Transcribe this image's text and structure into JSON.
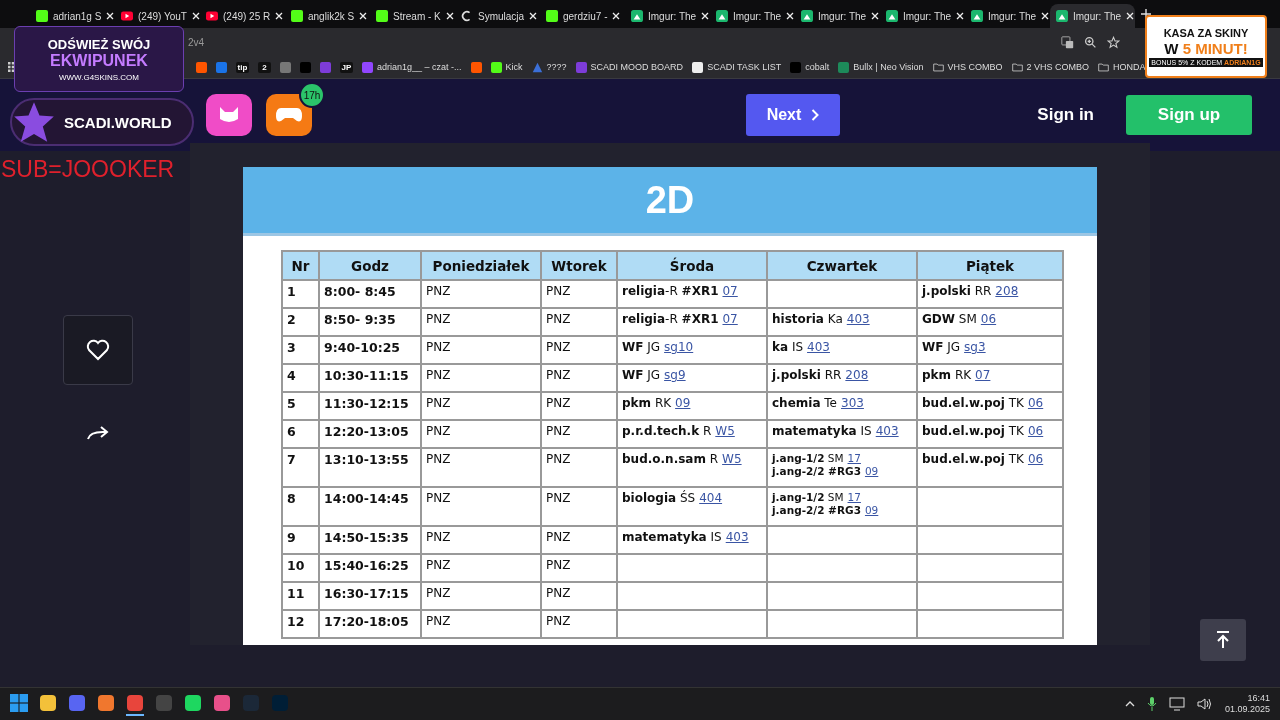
{
  "browser": {
    "tabs": [
      {
        "title": "adrian1g S",
        "kind": "kick",
        "selected": false
      },
      {
        "title": "(249) YouT",
        "kind": "youtube",
        "selected": false
      },
      {
        "title": "(249) 25 R",
        "kind": "youtube",
        "selected": false
      },
      {
        "title": "anglik2k S",
        "kind": "kick",
        "selected": false
      },
      {
        "title": "Stream - K",
        "kind": "kick",
        "selected": false
      },
      {
        "title": "Symulacja",
        "kind": "generic",
        "selected": false
      },
      {
        "title": "gerdziu7 -",
        "kind": "kick",
        "selected": false
      },
      {
        "title": "Imgur: The",
        "kind": "imgur",
        "selected": false
      },
      {
        "title": "Imgur: The",
        "kind": "imgur",
        "selected": false
      },
      {
        "title": "Imgur: The",
        "kind": "imgur",
        "selected": false
      },
      {
        "title": "Imgur: The",
        "kind": "imgur",
        "selected": false
      },
      {
        "title": "Imgur: The",
        "kind": "imgur",
        "selected": false
      },
      {
        "title": "Imgur: The",
        "kind": "imgur",
        "selected": true
      }
    ],
    "address": "2v4",
    "bookmarks": [
      {
        "kind": "soundcloud"
      },
      {
        "kind": "paypal"
      },
      {
        "kind": "text",
        "glyph": "tip"
      },
      {
        "kind": "text",
        "glyph": "2"
      },
      {
        "kind": "epic"
      },
      {
        "kind": "tiktok"
      },
      {
        "kind": "purple"
      },
      {
        "kind": "text",
        "glyph": "JP"
      },
      {
        "kind": "twitch",
        "label": "adrian1g__ – czat -..."
      },
      {
        "kind": "soundcloud"
      },
      {
        "kind": "kick",
        "label": "Kick"
      },
      {
        "kind": "triangle",
        "label": "????"
      },
      {
        "kind": "purple",
        "label": "SCADI MOOD BOARD"
      },
      {
        "kind": "notion",
        "label": "SCADI TASK LIST"
      },
      {
        "kind": "terminal",
        "label": "cobalt"
      },
      {
        "kind": "bull",
        "label": "Bullx | Neo Vision"
      },
      {
        "kind": "folder",
        "label": "VHS COMBO"
      },
      {
        "kind": "folder",
        "label": "2 VHS COMBO"
      },
      {
        "kind": "folder",
        "label": "HONDA"
      }
    ]
  },
  "page": {
    "apps": [
      {
        "kind": "pink"
      },
      {
        "kind": "gamepad",
        "badge": "17h"
      }
    ],
    "next_button": "Next",
    "sign_in": "Sign in",
    "sign_up": "Sign up",
    "image": {
      "title": "2D",
      "table": {
        "columns": [
          "Nr",
          "Godz",
          "Poniedziałek",
          "Wtorek",
          "Środa",
          "Czwartek",
          "Piątek"
        ],
        "rows": [
          {
            "cells": [
              {
                "entries": [
                  {
                    "text": "1"
                  }
                ]
              },
              {
                "entries": [
                  {
                    "text": "8:00- 8:45"
                  }
                ]
              },
              {
                "entries": [
                  {
                    "text": "PNZ"
                  }
                ]
              },
              {
                "entries": [
                  {
                    "text": "PNZ"
                  }
                ]
              },
              {
                "entries": [
                  {
                    "text": "**religia**-R **#XR1**",
                    "room": "07"
                  }
                ]
              },
              {},
              {
                "entries": [
                  {
                    "text": "**j.polski** RR",
                    "room": "208"
                  }
                ]
              }
            ]
          },
          {
            "cells": [
              {
                "entries": [
                  {
                    "text": "2"
                  }
                ]
              },
              {
                "entries": [
                  {
                    "text": "8:50- 9:35"
                  }
                ]
              },
              {
                "entries": [
                  {
                    "text": "PNZ"
                  }
                ]
              },
              {
                "entries": [
                  {
                    "text": "PNZ"
                  }
                ]
              },
              {
                "entries": [
                  {
                    "text": "**religia**-R **#XR1**",
                    "room": "07"
                  }
                ]
              },
              {
                "entries": [
                  {
                    "text": "**historia** Ka",
                    "room": "403"
                  }
                ]
              },
              {
                "entries": [
                  {
                    "text": "**GDW** SM",
                    "room": "06"
                  }
                ]
              }
            ]
          },
          {
            "cells": [
              {
                "entries": [
                  {
                    "text": "3"
                  }
                ]
              },
              {
                "entries": [
                  {
                    "text": "9:40-10:25"
                  }
                ]
              },
              {
                "entries": [
                  {
                    "text": "PNZ"
                  }
                ]
              },
              {
                "entries": [
                  {
                    "text": "PNZ"
                  }
                ]
              },
              {
                "entries": [
                  {
                    "text": "**WF** JG",
                    "room": "sg10"
                  }
                ]
              },
              {
                "entries": [
                  {
                    "text": "**ka** IS",
                    "room": "403"
                  }
                ]
              },
              {
                "entries": [
                  {
                    "text": "**WF** JG",
                    "room": "sg3"
                  }
                ]
              }
            ]
          },
          {
            "cells": [
              {
                "entries": [
                  {
                    "text": "4"
                  }
                ]
              },
              {
                "entries": [
                  {
                    "text": "10:30-11:15"
                  }
                ]
              },
              {
                "entries": [
                  {
                    "text": "PNZ"
                  }
                ]
              },
              {
                "entries": [
                  {
                    "text": "PNZ"
                  }
                ]
              },
              {
                "entries": [
                  {
                    "text": "**WF** JG",
                    "room": "sg9"
                  }
                ]
              },
              {
                "entries": [
                  {
                    "text": "**j.polski** RR",
                    "room": "208"
                  }
                ]
              },
              {
                "entries": [
                  {
                    "text": "**pkm** RK",
                    "room": "07"
                  }
                ]
              }
            ]
          },
          {
            "cells": [
              {
                "entries": [
                  {
                    "text": "5"
                  }
                ]
              },
              {
                "entries": [
                  {
                    "text": "11:30-12:15"
                  }
                ]
              },
              {
                "entries": [
                  {
                    "text": "PNZ"
                  }
                ]
              },
              {
                "entries": [
                  {
                    "text": "PNZ"
                  }
                ]
              },
              {
                "entries": [
                  {
                    "text": "**pkm** RK",
                    "room": "09"
                  }
                ]
              },
              {
                "entries": [
                  {
                    "text": "**chemia** Te",
                    "room": "303"
                  }
                ]
              },
              {
                "entries": [
                  {
                    "text": "**bud.el.w.poj** TK",
                    "room": "06"
                  }
                ]
              }
            ]
          },
          {
            "cells": [
              {
                "entries": [
                  {
                    "text": "6"
                  }
                ]
              },
              {
                "entries": [
                  {
                    "text": "12:20-13:05"
                  }
                ]
              },
              {
                "entries": [
                  {
                    "text": "PNZ"
                  }
                ]
              },
              {
                "entries": [
                  {
                    "text": "PNZ"
                  }
                ]
              },
              {
                "entries": [
                  {
                    "text": "**p.r.d.tech.k** R",
                    "room": "W5"
                  }
                ]
              },
              {
                "entries": [
                  {
                    "text": "**matematyka** IS",
                    "room": "403"
                  }
                ]
              },
              {
                "entries": [
                  {
                    "text": "**bud.el.w.poj** TK",
                    "room": "06"
                  }
                ]
              }
            ]
          },
          {
            "cells": [
              {
                "entries": [
                  {
                    "text": "7"
                  }
                ]
              },
              {
                "entries": [
                  {
                    "text": "13:10-13:55"
                  }
                ]
              },
              {
                "entries": [
                  {
                    "text": "PNZ"
                  }
                ]
              },
              {
                "entries": [
                  {
                    "text": "PNZ"
                  }
                ]
              },
              {
                "entries": [
                  {
                    "text": "**bud.o.n.sam** R",
                    "room": "W5"
                  }
                ]
              },
              {
                "entries": [
                  {
                    "text": "**j.ang-1/2** SM",
                    "room": "17"
                  },
                  {
                    "text": "**j.ang-2/2 #RG3**",
                    "room": "09"
                  }
                ]
              },
              {
                "entries": [
                  {
                    "text": "**bud.el.w.poj** TK",
                    "room": "06"
                  }
                ]
              }
            ]
          },
          {
            "cells": [
              {
                "entries": [
                  {
                    "text": "8"
                  }
                ]
              },
              {
                "entries": [
                  {
                    "text": "14:00-14:45"
                  }
                ]
              },
              {
                "entries": [
                  {
                    "text": "PNZ"
                  }
                ]
              },
              {
                "entries": [
                  {
                    "text": "PNZ"
                  }
                ]
              },
              {
                "entries": [
                  {
                    "text": "**biologia** ŚS",
                    "room": "404"
                  }
                ]
              },
              {
                "entries": [
                  {
                    "text": "**j.ang-1/2** SM",
                    "room": "17"
                  },
                  {
                    "text": "**j.ang-2/2 #RG3**",
                    "room": "09"
                  }
                ]
              },
              {}
            ]
          },
          {
            "cells": [
              {
                "entries": [
                  {
                    "text": "9"
                  }
                ]
              },
              {
                "entries": [
                  {
                    "text": "14:50-15:35"
                  }
                ]
              },
              {
                "entries": [
                  {
                    "text": "PNZ"
                  }
                ]
              },
              {
                "entries": [
                  {
                    "text": "PNZ"
                  }
                ]
              },
              {
                "entries": [
                  {
                    "text": "**matematyka** IS",
                    "room": "403"
                  }
                ]
              },
              {},
              {}
            ]
          },
          {
            "cells": [
              {
                "entries": [
                  {
                    "text": "10"
                  }
                ]
              },
              {
                "entries": [
                  {
                    "text": "15:40-16:25"
                  }
                ]
              },
              {
                "entries": [
                  {
                    "text": "PNZ"
                  }
                ]
              },
              {
                "entries": [
                  {
                    "text": "PNZ"
                  }
                ]
              },
              {},
              {},
              {}
            ]
          },
          {
            "cells": [
              {
                "entries": [
                  {
                    "text": "11"
                  }
                ]
              },
              {
                "entries": [
                  {
                    "text": "16:30-17:15"
                  }
                ]
              },
              {
                "entries": [
                  {
                    "text": "PNZ"
                  }
                ]
              },
              {
                "entries": [
                  {
                    "text": "PNZ"
                  }
                ]
              },
              {},
              {},
              {}
            ]
          },
          {
            "cells": [
              {
                "entries": [
                  {
                    "text": "12"
                  }
                ]
              },
              {
                "entries": [
                  {
                    "text": "17:20-18:05"
                  }
                ]
              },
              {
                "entries": [
                  {
                    "text": "PNZ"
                  }
                ]
              },
              {
                "entries": [
                  {
                    "text": "PNZ"
                  }
                ]
              },
              {},
              {},
              {}
            ]
          }
        ]
      }
    }
  },
  "overlays": {
    "ad_left": {
      "line1": "ODŚWIEŻ SWÓJ",
      "line2": "EKWIPUNEK",
      "url": "WWW.G4SKINS.COM"
    },
    "channel_badge": "SCADI.WORLD",
    "sub_text": "SUB=JOOOKER",
    "ad_right": {
      "line1": "KASA ZA SKINY",
      "line2_a": "W",
      "line2_b": "5 MINUT!",
      "bonus_a": "BONUS 5% Z KODEM",
      "bonus_b": "ADRIAN1G"
    }
  },
  "taskbar": {
    "apps": [
      {
        "kind": "windows",
        "active": false
      },
      {
        "kind": "folder",
        "active": false
      },
      {
        "kind": "discord",
        "active": false
      },
      {
        "kind": "orange",
        "active": false
      },
      {
        "kind": "chrome",
        "active": true
      },
      {
        "kind": "obs",
        "active": false
      },
      {
        "kind": "spotify",
        "active": false
      },
      {
        "kind": "colorful",
        "active": false
      },
      {
        "kind": "steam",
        "active": false
      },
      {
        "kind": "lightroom",
        "active": false
      }
    ],
    "time": "16:41",
    "date": "01.09.2025"
  }
}
